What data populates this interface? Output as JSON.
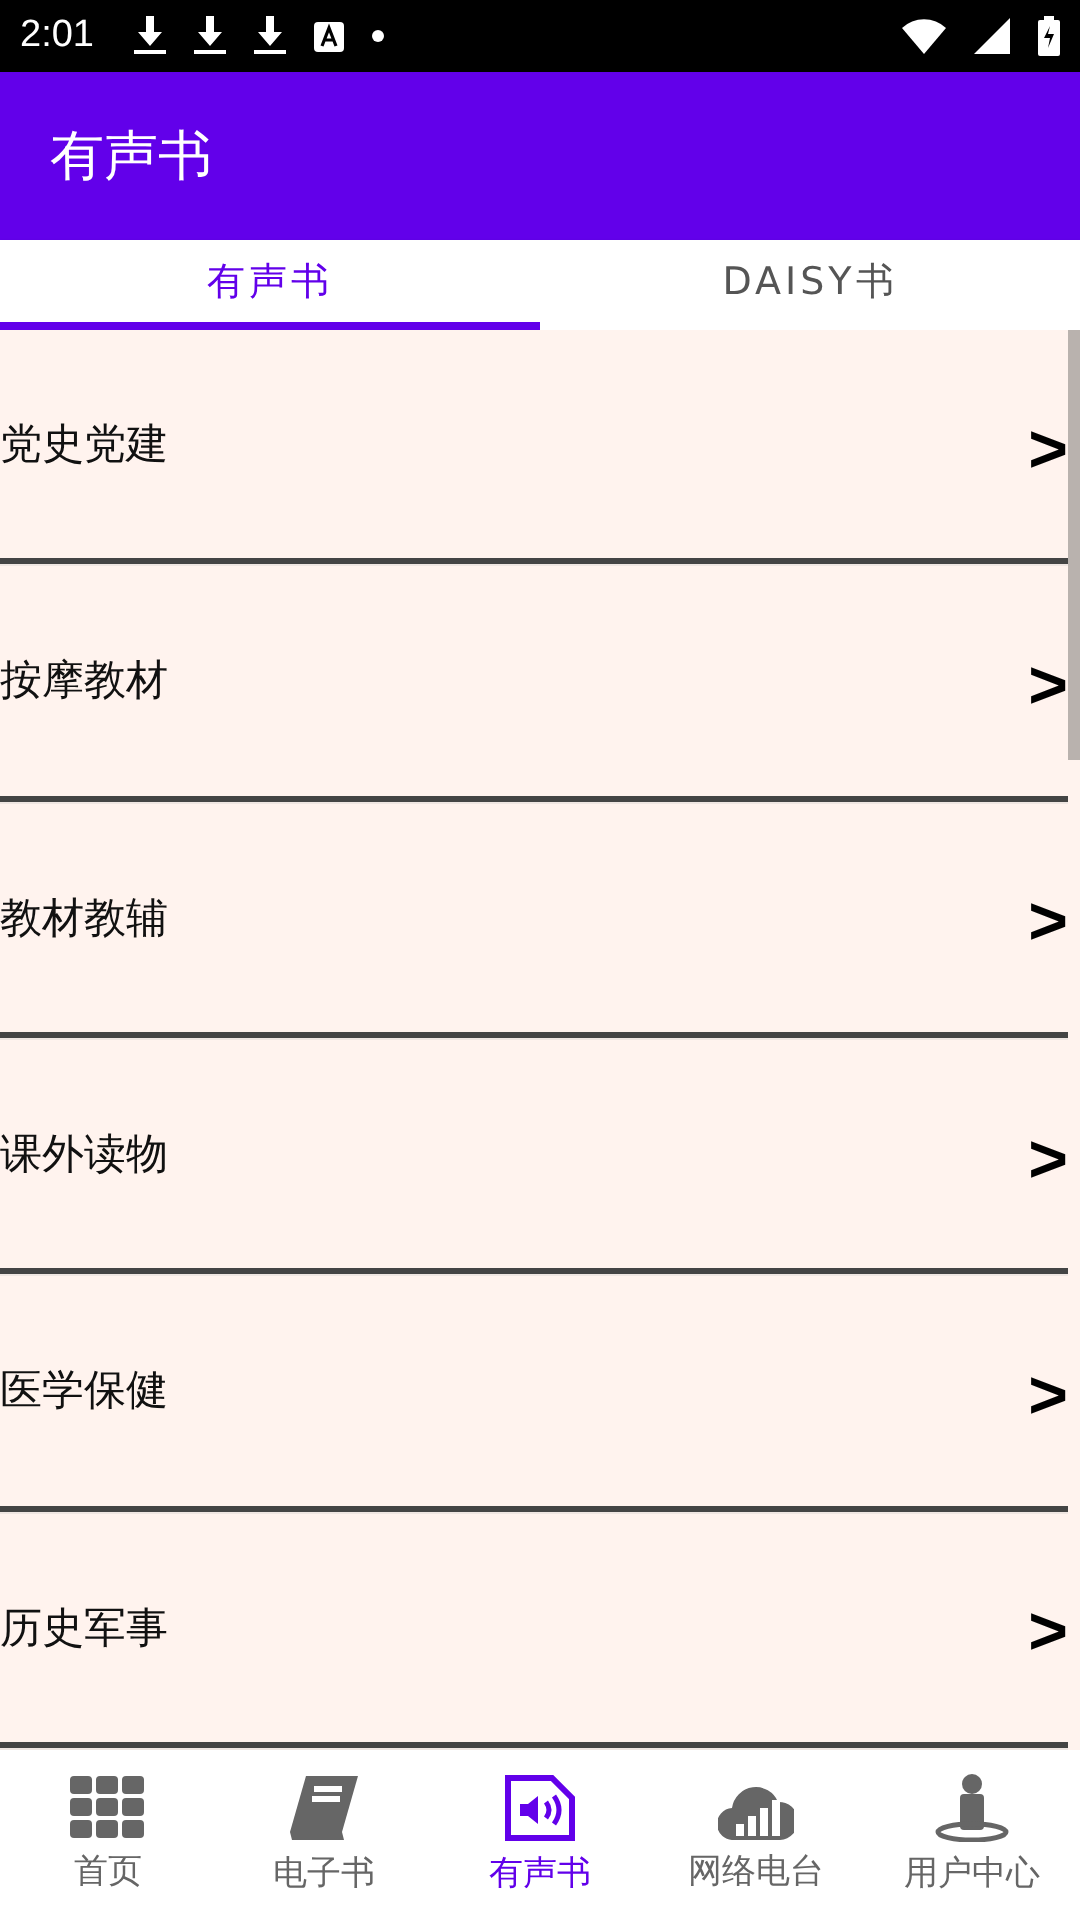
{
  "status_bar": {
    "time": "2:01"
  },
  "app_bar": {
    "title": "有声书"
  },
  "tabs": [
    {
      "label": "有声书",
      "selected": true
    },
    {
      "label": "DAISY书",
      "selected": false
    }
  ],
  "categories": [
    {
      "label": "党史党建",
      "arrow": ">"
    },
    {
      "label": "按摩教材",
      "arrow": ">"
    },
    {
      "label": "教材教辅",
      "arrow": ">"
    },
    {
      "label": "课外读物",
      "arrow": ">"
    },
    {
      "label": "医学保健",
      "arrow": ">"
    },
    {
      "label": "历史军事",
      "arrow": ">"
    }
  ],
  "bottom_nav": [
    {
      "kind": "grid",
      "label": "首页",
      "selected": false
    },
    {
      "kind": "book",
      "label": "电子书",
      "selected": false
    },
    {
      "kind": "audio",
      "label": "有声书",
      "selected": true
    },
    {
      "kind": "radio",
      "label": "网络电台",
      "selected": false
    },
    {
      "kind": "user",
      "label": "用户中心",
      "selected": false
    }
  ]
}
